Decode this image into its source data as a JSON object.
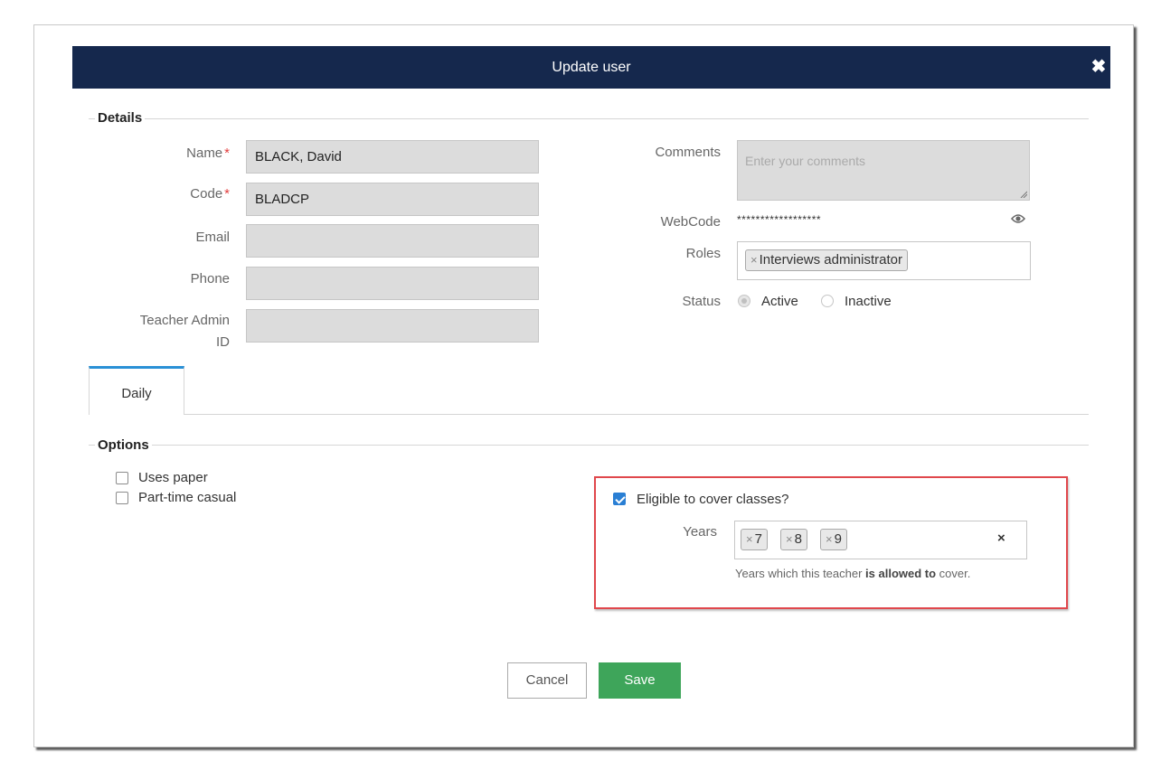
{
  "dialog": {
    "title": "Update user",
    "close_icon": "close-icon"
  },
  "details": {
    "legend": "Details",
    "name_label": "Name",
    "name_value": "BLACK, David",
    "code_label": "Code",
    "code_value": "BLADCP",
    "email_label": "Email",
    "email_value": "",
    "phone_label": "Phone",
    "phone_value": "",
    "teacher_admin_label_1": "Teacher Admin",
    "teacher_admin_label_2": "ID",
    "teacher_admin_value": "",
    "required_mark": "*",
    "comments_label": "Comments",
    "comments_placeholder": "Enter your comments",
    "webcode_label": "WebCode",
    "webcode_value": "******************",
    "roles_label": "Roles",
    "roles": [
      "Interviews administrator"
    ],
    "status_label": "Status",
    "status_active": "Active",
    "status_inactive": "Inactive",
    "status_selected": "Active"
  },
  "tabs": [
    "Daily"
  ],
  "options": {
    "legend": "Options",
    "uses_paper": "Uses paper",
    "uses_paper_checked": false,
    "part_time_casual": "Part-time casual",
    "part_time_casual_checked": false,
    "eligible_label": "Eligible to cover classes?",
    "eligible_checked": true,
    "years_label": "Years",
    "years": [
      "7",
      "8",
      "9"
    ],
    "tag_remove": "×",
    "clear_all": "×",
    "help_prefix": "Years which this teacher ",
    "help_bold": "is allowed to",
    "help_suffix": " cover."
  },
  "buttons": {
    "cancel": "Cancel",
    "save": "Save"
  },
  "colors": {
    "header_bg": "#15284d",
    "tab_accent": "#2a90d6",
    "save_bg": "#3ea55a",
    "highlight_border": "#e0474c",
    "checkbox_on": "#2a7fd4"
  }
}
